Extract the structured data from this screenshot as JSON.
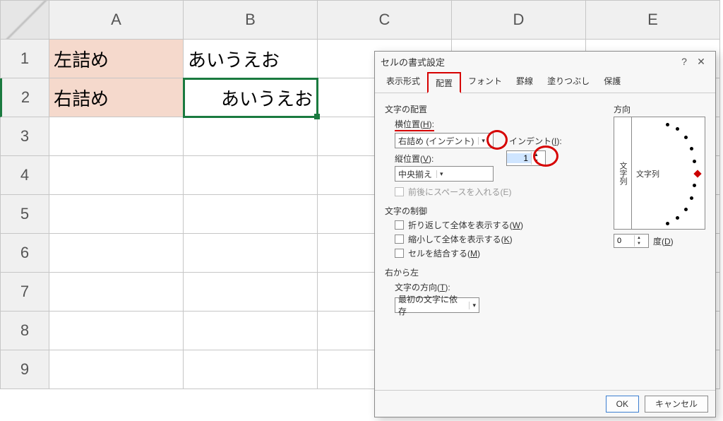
{
  "columns": [
    "A",
    "B",
    "C",
    "D",
    "E"
  ],
  "rows": {
    "1": {
      "A": "左詰め",
      "B": "あいうえお"
    },
    "2": {
      "A": "右詰め",
      "B": "あいうえお"
    }
  },
  "row_count": 9,
  "active": {
    "row": 2,
    "col": "B"
  },
  "dialog": {
    "title": "セルの書式設定",
    "help": "?",
    "close": "✕",
    "tabs": {
      "t1": "表示形式",
      "t2": "配置",
      "t3": "フォント",
      "t4": "罫線",
      "t5": "塗りつぶし",
      "t6": "保護"
    },
    "group_textalign": "文字の配置",
    "horiz_label_a": "横位置(",
    "horiz_label_b": "H",
    "horiz_label_c": "):",
    "horiz_value": "右詰め (インデント)",
    "indent_label_a": "インデント(",
    "indent_label_b": "I",
    "indent_label_c": "):",
    "indent_value": "1",
    "vert_label_a": "縦位置(",
    "vert_label_b": "V",
    "vert_label_c": "):",
    "vert_value": "中央揃え",
    "justify_dist": "前後にスペースを入れる(E)",
    "group_control": "文字の制御",
    "wrap_a": "折り返して全体を表示する(",
    "wrap_b": "W",
    "wrap_c": ")",
    "shrink_a": "縮小して全体を表示する(",
    "shrink_b": "K",
    "shrink_c": ")",
    "merge_a": "セルを結合する(",
    "merge_b": "M",
    "merge_c": ")",
    "group_rtl": "右から左",
    "dir_label_a": "文字の方向(",
    "dir_label_b": "T",
    "dir_label_c": "):",
    "dir_value": "最初の文字に依存",
    "orient_title": "方向",
    "orient_vert": "文字列",
    "orient_h": "文字列",
    "degree_value": "0",
    "degree_label_a": "度(",
    "degree_label_b": "D",
    "degree_label_c": ")",
    "ok": "OK",
    "cancel": "キャンセル"
  }
}
